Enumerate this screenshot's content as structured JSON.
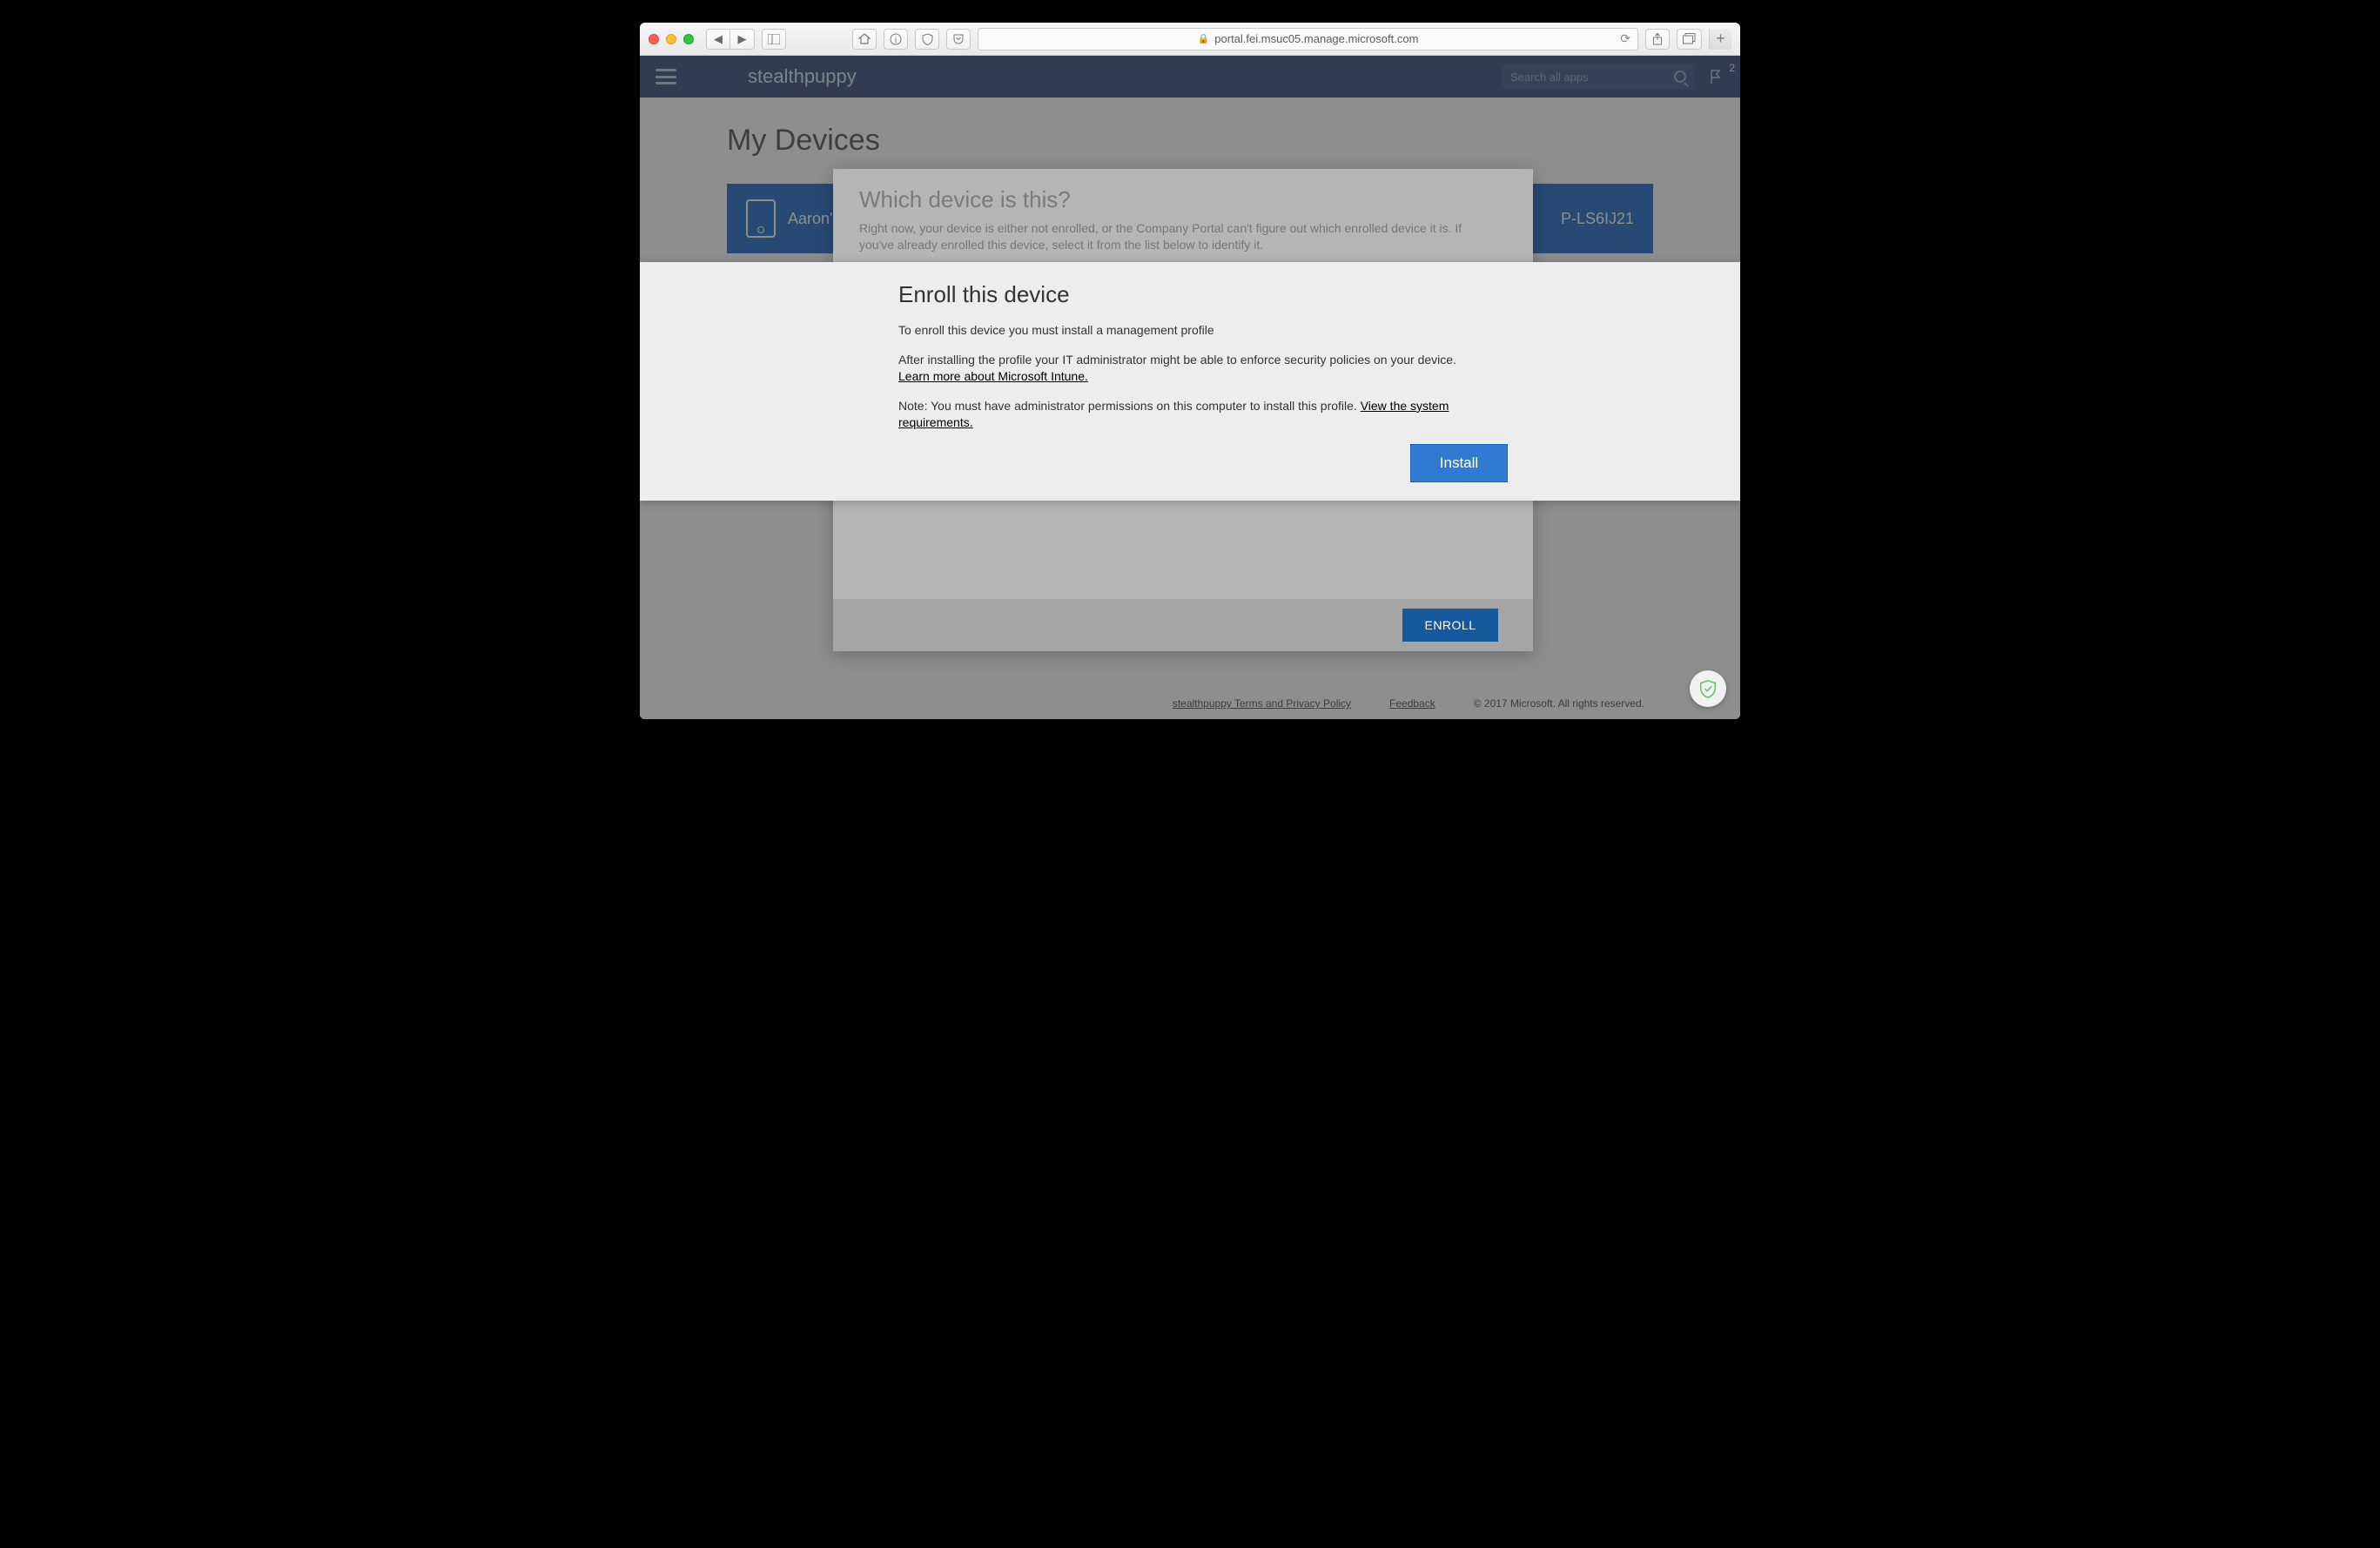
{
  "browser": {
    "address": "portal.fei.msuc05.manage.microsoft.com"
  },
  "header": {
    "brand": "stealthpuppy",
    "search_placeholder": "Search all apps",
    "notification_count": "2"
  },
  "page": {
    "title": "My Devices",
    "devices": {
      "left_label": "Aaron's",
      "right_label": "P-LS6IJ21"
    }
  },
  "outer_dialog": {
    "title": "Which device is this?",
    "body": "Right now, your device is either not enrolled, or the Company Portal can't figure out which enrolled device it is. If you've already enrolled this device, select it from the list below to identify it.",
    "enroll_button": "ENROLL"
  },
  "inner_dialog": {
    "title": "Enroll this device",
    "line1": "To enroll this device you must install a management profile",
    "line2": "After installing the profile your IT administrator might be able to enforce security policies on your device.",
    "learn_link": "Learn more about Microsoft Intune.",
    "note_prefix": "Note: You must have administrator permissions on this computer to install this profile. ",
    "note_link": "View the system requirements.",
    "install_button": "Install"
  },
  "footer": {
    "terms": "stealthpuppy Terms and Privacy Policy",
    "feedback": "Feedback",
    "copyright": "© 2017 Microsoft. All rights reserved."
  }
}
